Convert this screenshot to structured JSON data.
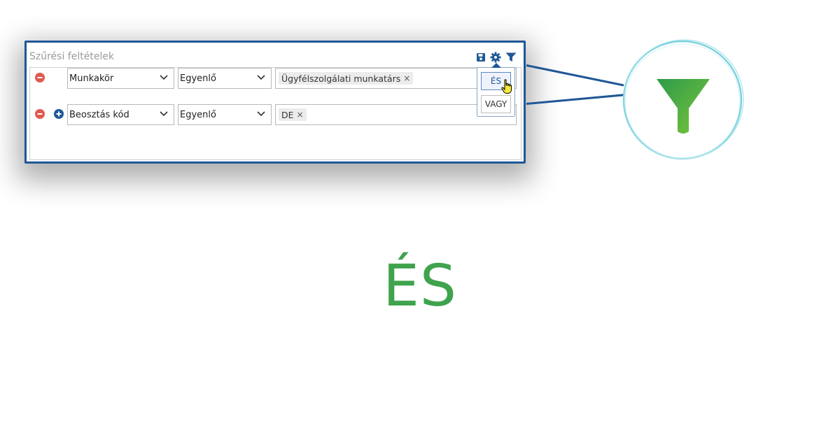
{
  "panel": {
    "title": "Szűrési feltételek",
    "toolbar_icons": [
      "save-icon",
      "gear-icon",
      "filter-icon"
    ]
  },
  "rows": [
    {
      "field": "Munkakör",
      "operator": "Egyenlő",
      "value_tag": "Ügyfélszolgálati munkatárs",
      "tag_remove": "×"
    },
    {
      "field": "Beosztás kód",
      "operator": "Egyenlő",
      "value_tag": "DE",
      "tag_remove": "×"
    }
  ],
  "logic_menu": {
    "options": [
      "ÉS",
      "VAGY"
    ],
    "selected": "ÉS"
  },
  "caption": "ÉS",
  "colors": {
    "accent_blue": "#1f5796",
    "remove_red": "#e05a4f",
    "green_text": "#3fa34d",
    "ring_cyan": "#7dd3df"
  }
}
